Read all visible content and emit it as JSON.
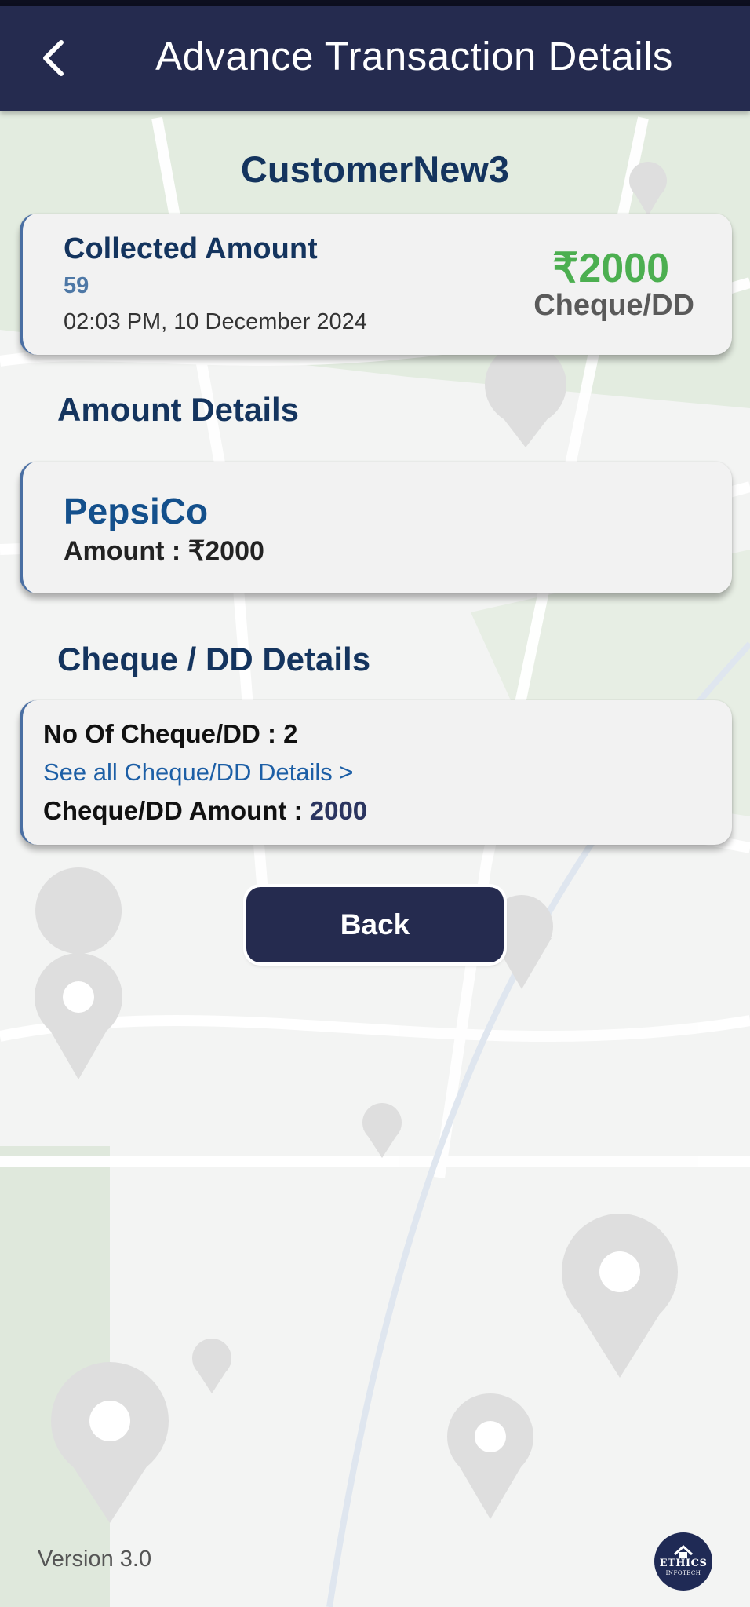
{
  "header": {
    "title": "Advance Transaction Details"
  },
  "customer": {
    "name": "CustomerNew3"
  },
  "collected": {
    "title": "Collected Amount",
    "id": "59",
    "datetime": "02:03 PM, 10 December 2024",
    "amount": "₹2000",
    "mode": "Cheque/DD"
  },
  "amount_details": {
    "section_title": "Amount Details",
    "company": "PepsiCo",
    "amount_line": "Amount : ₹2000"
  },
  "cheque_details": {
    "section_title": "Cheque / DD Details",
    "count_line": "No Of Cheque/DD : 2",
    "see_all_link": "See all Cheque/DD Details >",
    "amount_label": "Cheque/DD Amount : ",
    "amount_value": "2000"
  },
  "actions": {
    "back_label": "Back"
  },
  "footer": {
    "version": "Version 3.0",
    "logo_text": "ETHICS",
    "logo_subtext": "INFOTECH"
  },
  "colors": {
    "header_bg": "#252b4f",
    "amount_green": "#4caf50",
    "title_blue": "#14345e",
    "link_blue": "#1d5fa6"
  }
}
